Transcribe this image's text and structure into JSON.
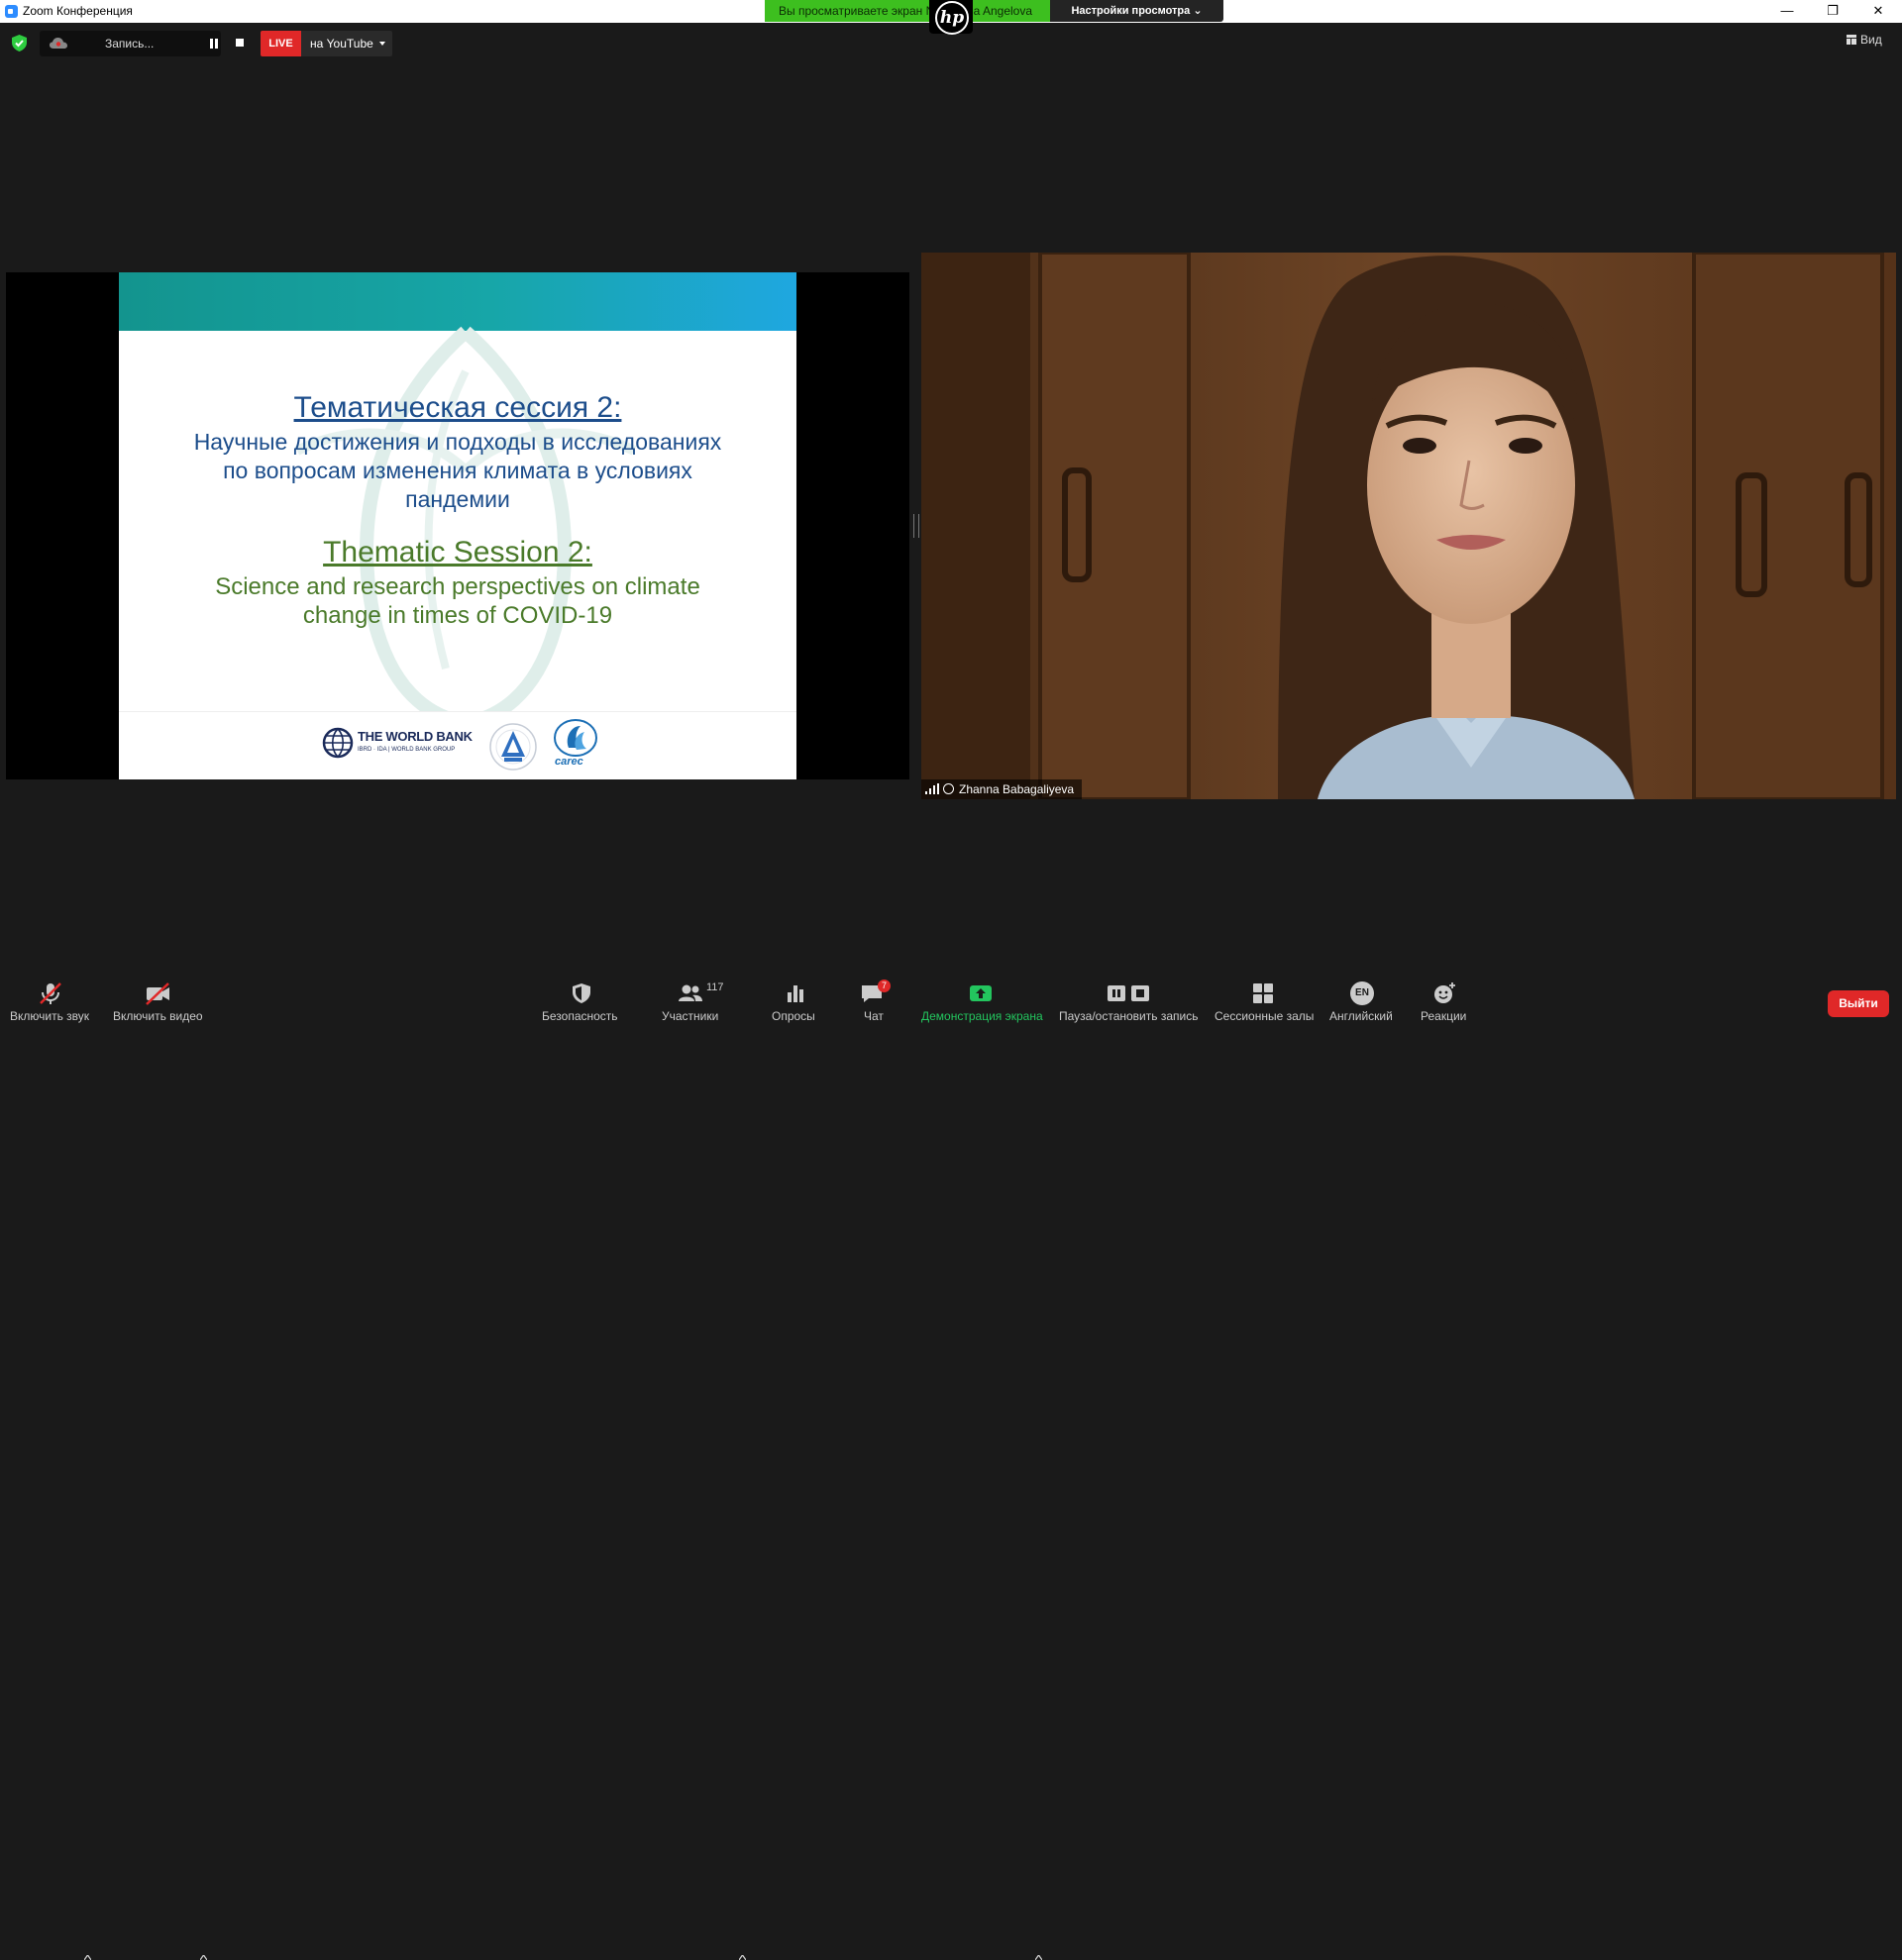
{
  "window": {
    "title": "Zoom Конференция",
    "minimize": "—",
    "restore": "❐",
    "close": "✕"
  },
  "share_banner": {
    "text": "Вы  просматриваете  экран  Nadezhda  Angelova",
    "view_settings": "Настройки просмотра ⌄"
  },
  "overlay_logo": "hp",
  "top_bar": {
    "recording_label": "Запись...",
    "live_label": "LIVE",
    "stream_target": "на YouTube",
    "view_label": "Вид"
  },
  "slide": {
    "ru_title": "Тематическая сессия 2:",
    "ru_subtitle": "Научные достижения и подходы в исследованиях по вопросам изменения климата в условиях пандемии",
    "en_title": "Thematic Session 2:",
    "en_subtitle": "Science and research perspectives on climate change in times of COVID-19",
    "wb_name": "THE WORLD BANK",
    "wb_sub": "IBRD · IDA | WORLD BANK GROUP",
    "carec_name": "carec"
  },
  "speaker": {
    "name": "Zhanna Babagaliyeva"
  },
  "toolbar": {
    "mute_label": "Включить звук",
    "video_label": "Включить видео",
    "security_label": "Безопасность",
    "participants_label": "Участники",
    "participants_count": "117",
    "polls_label": "Опросы",
    "chat_label": "Чат",
    "chat_badge": "7",
    "share_label": "Демонстрация экрана",
    "record_label": "Пауза/остановить запись",
    "breakout_label": "Сессионные залы",
    "language_code": "EN",
    "language_label": "Английский",
    "reactions_label": "Реакции",
    "leave_label": "Выйти"
  },
  "colors": {
    "accent_green": "#3dbf1f",
    "live_red": "#e02828",
    "share_green": "#23c55e",
    "slide_blue_text": "#1c4d8b",
    "slide_green_text": "#4a7a2a"
  }
}
